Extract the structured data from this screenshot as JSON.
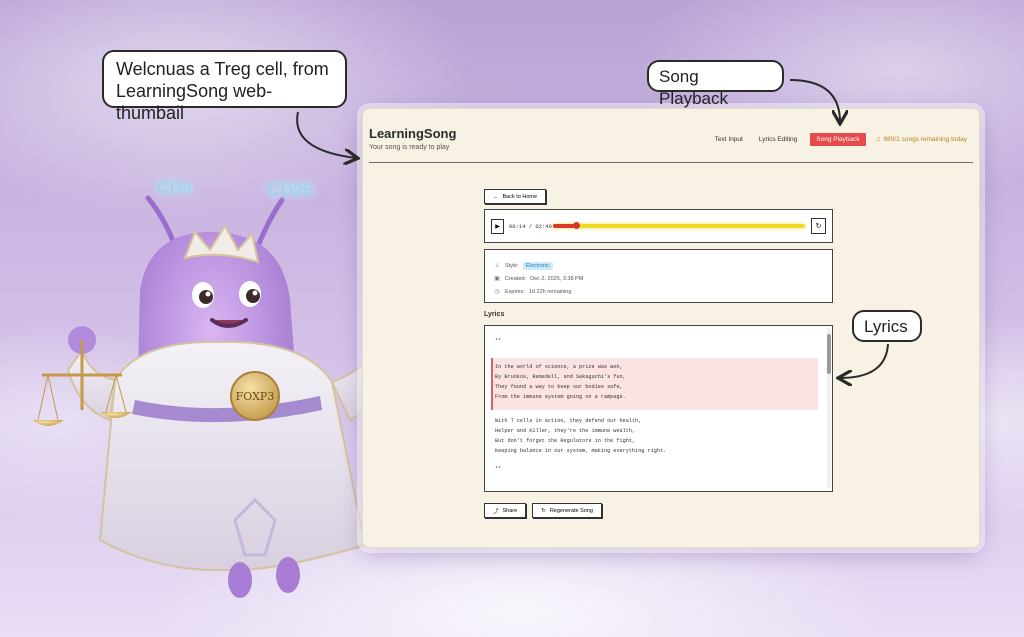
{
  "callouts": {
    "welcome_line1": "Welcnuas a Treg cell, from",
    "welcome_line2": "LearningSong web-thumbail",
    "song_playback": "Song Playback",
    "lyrics": "Lyrics"
  },
  "character": {
    "antenna_left": "CD4",
    "antenna_right": "CD25",
    "medallion": "FOXP3"
  },
  "app": {
    "title": "LearningSong",
    "subtitle": "Your song is ready to play",
    "nav": {
      "text_input": "Text Input",
      "lyrics_editing": "Lyrics Editing",
      "song_playback": "Song Playback",
      "songs_remaining": "989/2 songs remaining today"
    },
    "back_label": "Back to Home",
    "player": {
      "time": "00:14 / 02:49",
      "progress_fraction": 0.09
    },
    "info": {
      "style_label": "Style:",
      "style_value": "Electronic",
      "created_label": "Created:",
      "created_value": "Dec 2, 2025, 3:38 PM",
      "expires_label": "Expires:",
      "expires_value": "1d 22h remaining"
    },
    "lyrics_heading": "Lyrics",
    "lyrics": {
      "l1": "**",
      "l2": "In the world of science, a prize was won,",
      "l3": "By Brunkos, Ramsdell, and Sakaguchi's fun,",
      "l4": "They found a way to keep our bodies safe,",
      "l5": "From the immune system going on a rampage.",
      "l6": "With T cells in action, they defend our health,",
      "l7": "Helper and Killer, they're the immune wealth,",
      "l8": "But don't forget the Regulators in the fight,",
      "l9": "Keeping balance in our system, making everything right.",
      "l10": "**"
    },
    "share_label": "Share",
    "regenerate_label": "Regenerate Song"
  },
  "colors": {
    "active_tab": "#e64a4a",
    "progress": "#d83a2a",
    "track": "#efdc28",
    "highlight": "#fbe3e3"
  }
}
